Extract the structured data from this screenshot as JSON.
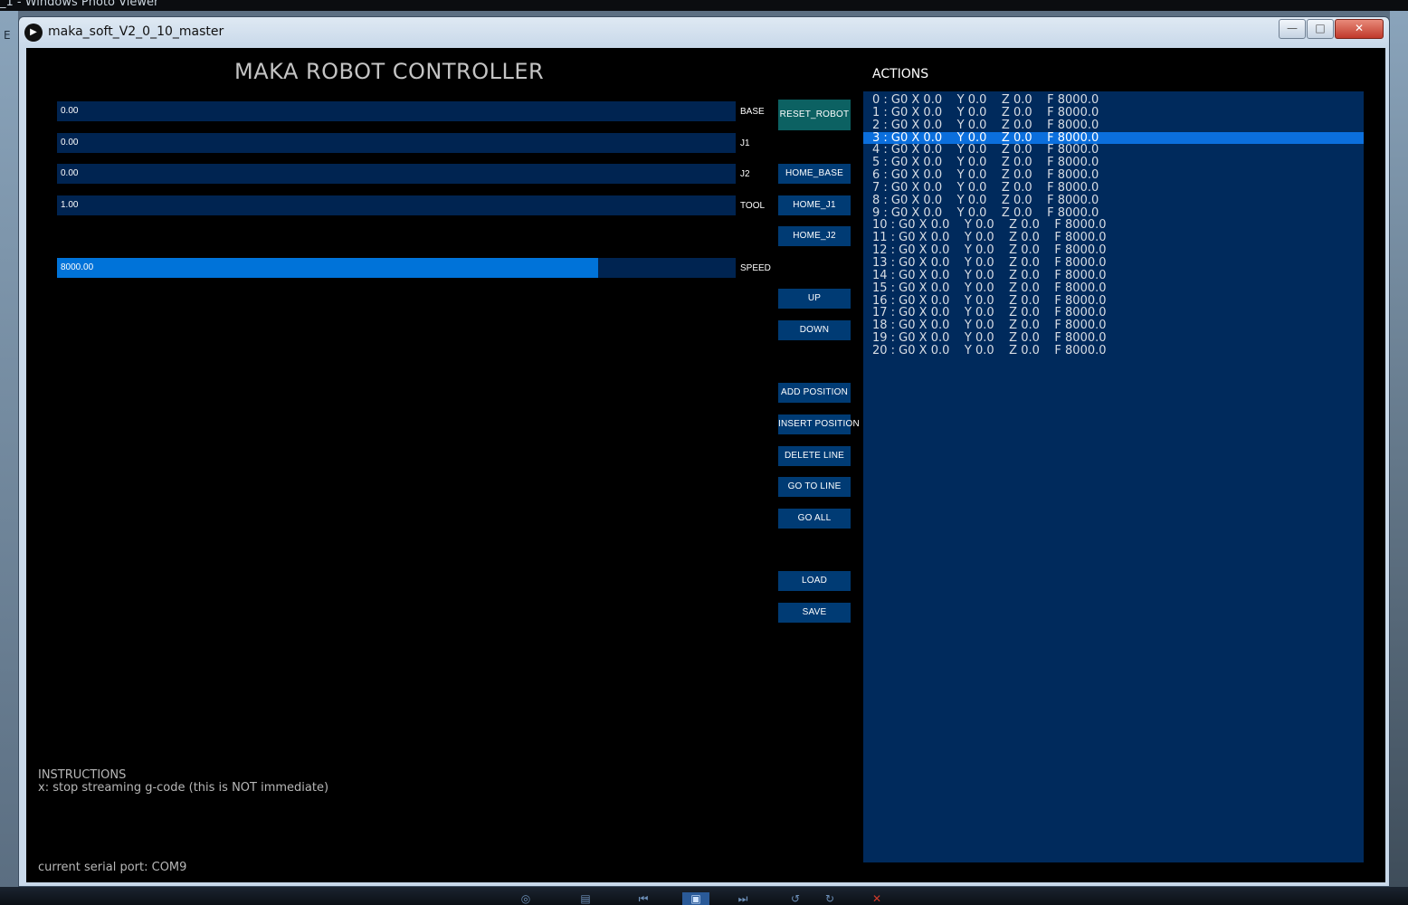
{
  "backdrop": {
    "title": "_1 - Windows Photo Viewer",
    "left_label": "E"
  },
  "window": {
    "title": "maka_soft_V2_0_10_master",
    "min_label": "—",
    "max_label": "□",
    "close_label": "✕"
  },
  "app": {
    "title": "MAKA ROBOT CONTROLLER",
    "sliders": [
      {
        "label": "BASE",
        "value": "0.00",
        "fill": 0
      },
      {
        "label": "J1",
        "value": "0.00",
        "fill": 0
      },
      {
        "label": "J2",
        "value": "0.00",
        "fill": 0
      },
      {
        "label": "TOOL",
        "value": "1.00",
        "fill": 0
      },
      {
        "label": "SPEED",
        "value": "8000.00",
        "fill": 0.797
      }
    ],
    "buttons": {
      "reset_robot": "RESET_ROBOT",
      "home_base": "HOME_BASE",
      "home_j1": "HOME_J1",
      "home_j2": "HOME_J2",
      "up": "UP",
      "down": "DOWN",
      "add_position": "ADD POSITION",
      "insert_position": "INSERT POSITION",
      "delete_line": "DELETE LINE",
      "go_to_line": "GO TO LINE",
      "go_all": "GO ALL",
      "load": "LOAD",
      "save": "SAVE"
    },
    "actions_title": "ACTIONS",
    "actions": [
      "0 : G0 X 0.0    Y 0.0    Z 0.0    F 8000.0",
      "1 : G0 X 0.0    Y 0.0    Z 0.0    F 8000.0",
      "2 : G0 X 0.0    Y 0.0    Z 0.0    F 8000.0",
      "3 : G0 X 0.0    Y 0.0    Z 0.0    F 8000.0",
      "4 : G0 X 0.0    Y 0.0    Z 0.0    F 8000.0",
      "5 : G0 X 0.0    Y 0.0    Z 0.0    F 8000.0",
      "6 : G0 X 0.0    Y 0.0    Z 0.0    F 8000.0",
      "7 : G0 X 0.0    Y 0.0    Z 0.0    F 8000.0",
      "8 : G0 X 0.0    Y 0.0    Z 0.0    F 8000.0",
      "9 : G0 X 0.0    Y 0.0    Z 0.0    F 8000.0",
      "10 : G0 X 0.0    Y 0.0    Z 0.0    F 8000.0",
      "11 : G0 X 0.0    Y 0.0    Z 0.0    F 8000.0",
      "12 : G0 X 0.0    Y 0.0    Z 0.0    F 8000.0",
      "13 : G0 X 0.0    Y 0.0    Z 0.0    F 8000.0",
      "14 : G0 X 0.0    Y 0.0    Z 0.0    F 8000.0",
      "15 : G0 X 0.0    Y 0.0    Z 0.0    F 8000.0",
      "16 : G0 X 0.0    Y 0.0    Z 0.0    F 8000.0",
      "17 : G0 X 0.0    Y 0.0    Z 0.0    F 8000.0",
      "18 : G0 X 0.0    Y 0.0    Z 0.0    F 8000.0",
      "19 : G0 X 0.0    Y 0.0    Z 0.0    F 8000.0",
      "20 : G0 X 0.0    Y 0.0    Z 0.0    F 8000.0"
    ],
    "selected_action": 3,
    "instructions_head": "INSTRUCTIONS",
    "instructions_line": "x: stop streaming g-code (this is NOT immediate)",
    "serial_port": "current serial port: COM9"
  },
  "colors": {
    "slider_track": "#002451",
    "slider_fill": "#0073d9",
    "button": "#003b74",
    "reset_button": "#0c6162",
    "actions_bg": "#002a5c",
    "actions_selected": "#0b6fdd"
  },
  "taskbar_icons": [
    "search-icon",
    "print-icon",
    "prev-icon",
    "slideshow-icon",
    "next-icon",
    "rotate-left-icon",
    "rotate-right-icon",
    "delete-icon"
  ]
}
